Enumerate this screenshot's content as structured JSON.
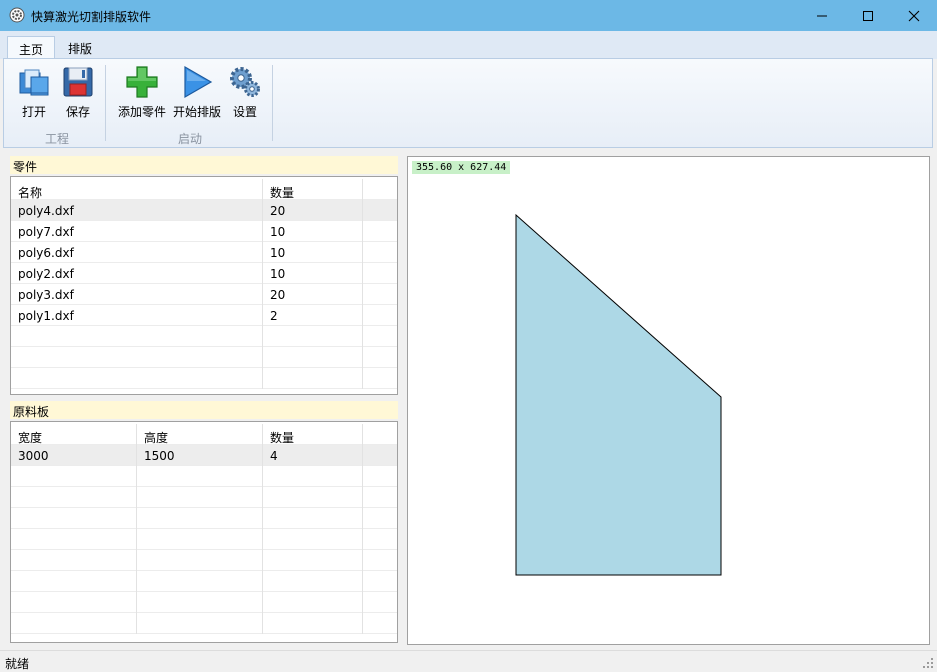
{
  "window": {
    "title": "快算激光切割排版软件"
  },
  "ribbon": {
    "tabs": [
      {
        "label": "主页",
        "active": true
      },
      {
        "label": "排版",
        "active": false
      }
    ],
    "groups": [
      {
        "label": "工程",
        "buttons": [
          {
            "label": "打开",
            "icon": "open-folder-icon"
          },
          {
            "label": "保存",
            "icon": "save-disk-icon"
          }
        ]
      },
      {
        "label": "启动",
        "buttons": [
          {
            "label": "添加零件",
            "icon": "add-plus-icon"
          },
          {
            "label": "开始排版",
            "icon": "play-icon"
          },
          {
            "label": "设置",
            "icon": "gears-icon"
          }
        ]
      }
    ]
  },
  "parts": {
    "title": "零件",
    "columns": [
      "名称",
      "数量"
    ],
    "rows": [
      [
        "poly4.dxf",
        "20"
      ],
      [
        "poly7.dxf",
        "10"
      ],
      [
        "poly6.dxf",
        "10"
      ],
      [
        "poly2.dxf",
        "10"
      ],
      [
        "poly3.dxf",
        "20"
      ],
      [
        "poly1.dxf",
        "2"
      ]
    ]
  },
  "sheets": {
    "title": "原料板",
    "columns": [
      "宽度",
      "高度",
      "数量"
    ],
    "rows": [
      [
        "3000",
        "1500",
        "4"
      ]
    ]
  },
  "preview": {
    "dimensions": "355.60 x 627.44",
    "shape_fill": "#add8e6"
  },
  "status": {
    "text": "就绪"
  }
}
